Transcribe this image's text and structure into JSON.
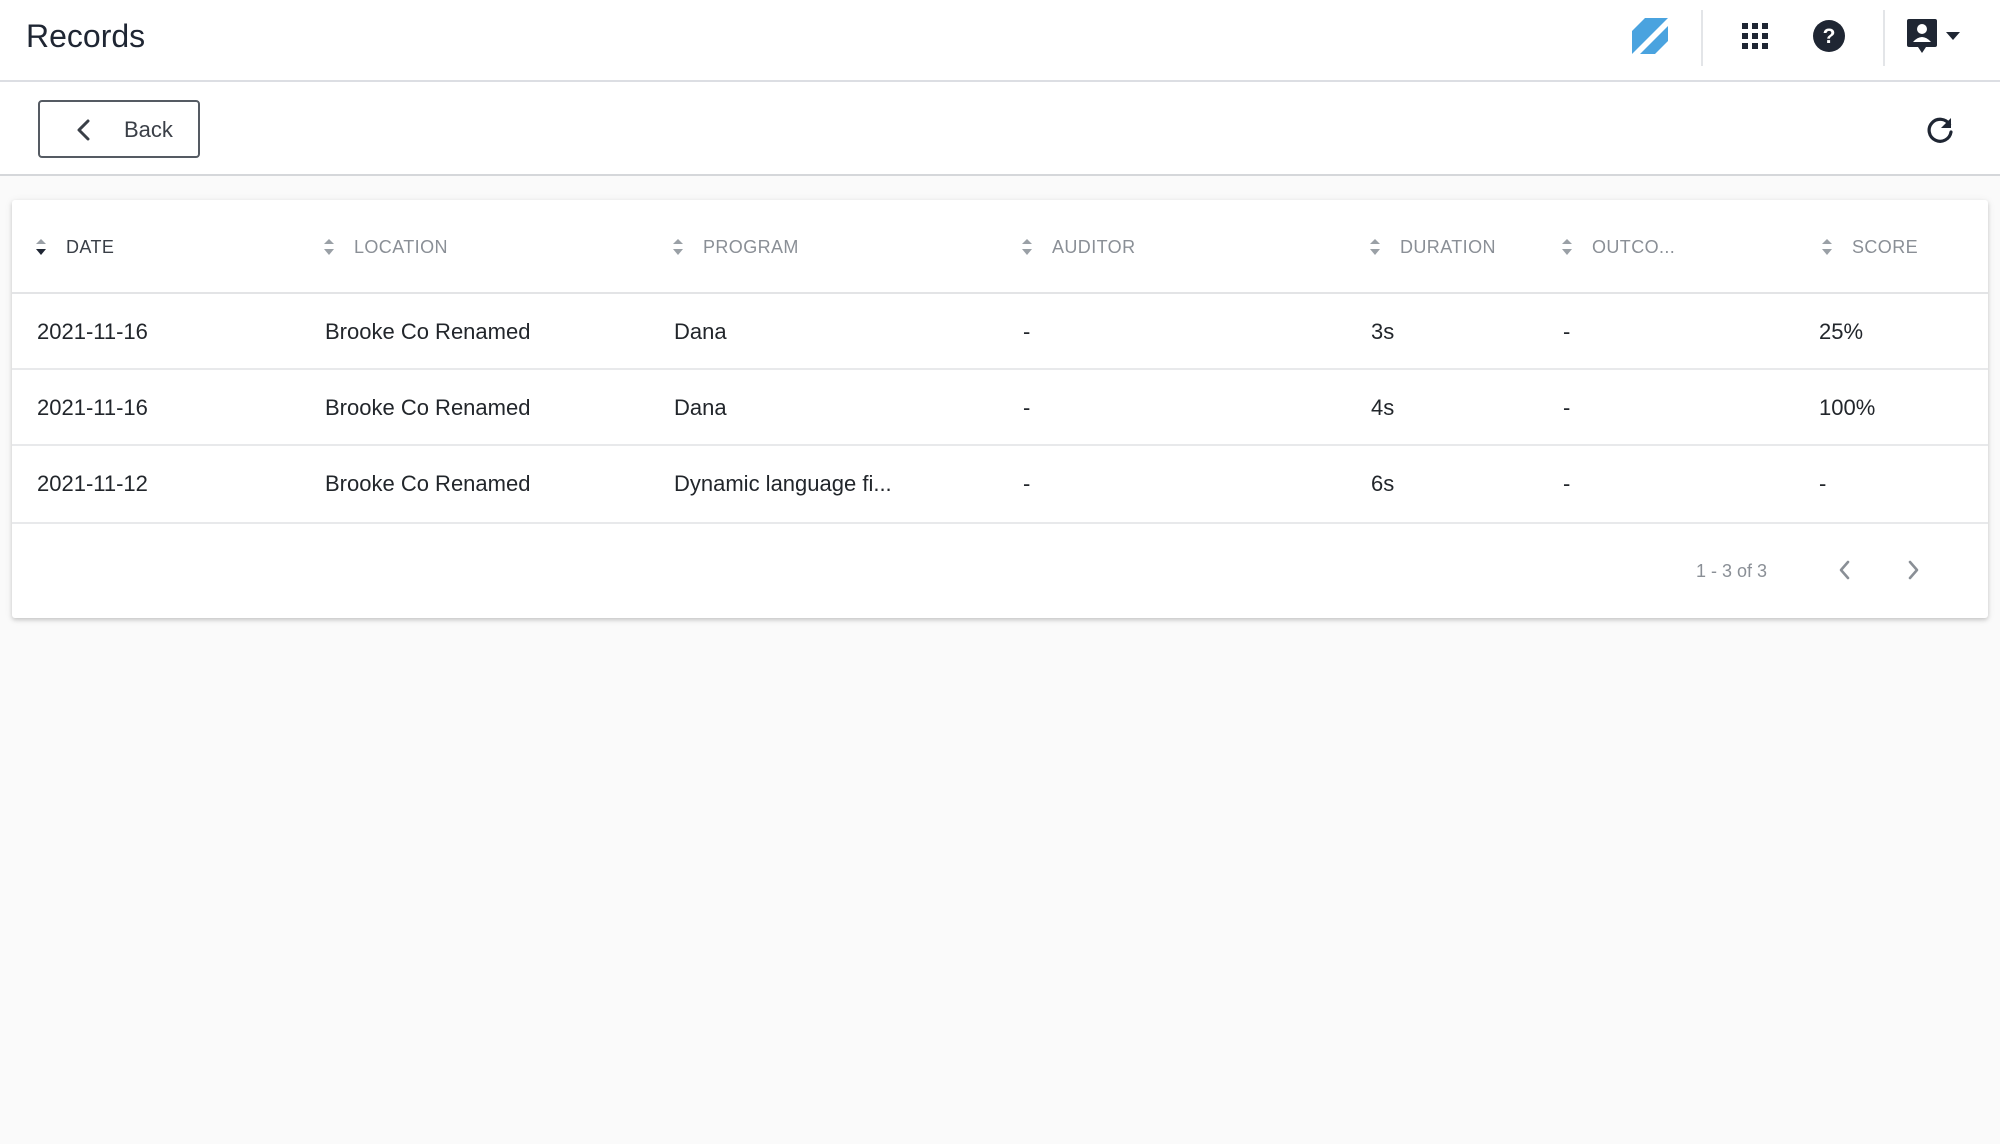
{
  "header": {
    "title": "Records",
    "icons": [
      "brand-logo-icon",
      "apps-grid-icon",
      "help-icon",
      "account-icon",
      "caret-down-icon"
    ],
    "brand_color": "#4aa3df"
  },
  "toolbar": {
    "back_label": "Back",
    "icons": [
      "chevron-left-icon",
      "refresh-icon"
    ]
  },
  "table": {
    "columns": [
      "DATE",
      "LOCATION",
      "PROGRAM",
      "AUDITOR",
      "DURATION",
      "OUTCO...",
      "SCORE"
    ],
    "active_sort_column": "DATE",
    "rows": [
      [
        "2021-11-16",
        "Brooke Co Renamed",
        "Dana",
        "-",
        "3s",
        "-",
        "25%"
      ],
      [
        "2021-11-16",
        "Brooke Co Renamed",
        "Dana",
        "-",
        "4s",
        "-",
        "100%"
      ],
      [
        "2021-11-12",
        "Brooke Co Renamed",
        "Dynamic language fi...",
        "-",
        "6s",
        "-",
        "-"
      ]
    ]
  },
  "pagination": {
    "range_text": "1 - 3 of 3"
  }
}
